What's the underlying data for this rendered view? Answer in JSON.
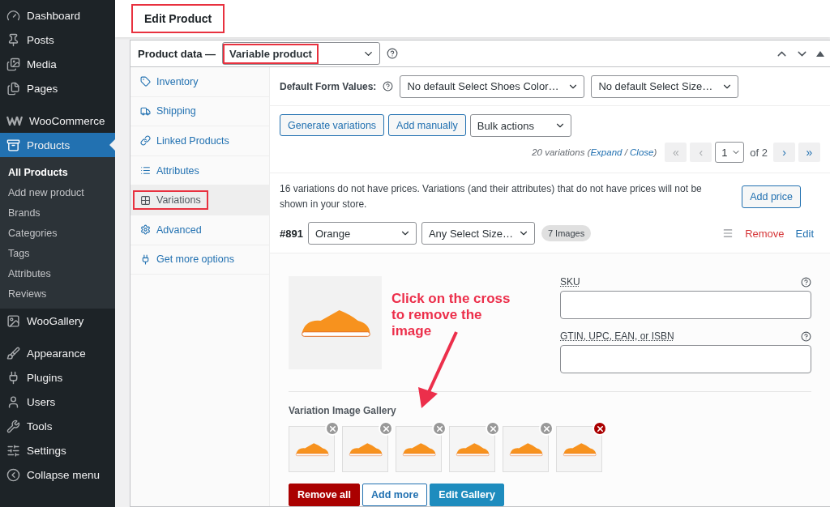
{
  "sidebar": {
    "groups": [
      [
        {
          "label": "Dashboard",
          "selected": false
        },
        {
          "label": "Posts",
          "selected": false
        },
        {
          "label": "Media",
          "selected": false
        },
        {
          "label": "Pages",
          "selected": false
        }
      ],
      [
        {
          "label": "WooCommerce",
          "selected": false
        },
        {
          "label": "Products",
          "selected": true,
          "children": [
            {
              "label": "All Products",
              "selected": true
            },
            {
              "label": "Add new product",
              "selected": false
            },
            {
              "label": "Brands",
              "selected": false
            },
            {
              "label": "Categories",
              "selected": false
            },
            {
              "label": "Tags",
              "selected": false
            },
            {
              "label": "Attributes",
              "selected": false
            },
            {
              "label": "Reviews",
              "selected": false
            }
          ]
        },
        {
          "label": "WooGallery",
          "selected": false
        }
      ],
      [
        {
          "label": "Appearance",
          "selected": false
        },
        {
          "label": "Plugins",
          "selected": false
        },
        {
          "label": "Users",
          "selected": false
        },
        {
          "label": "Tools",
          "selected": false
        },
        {
          "label": "Settings",
          "selected": false
        },
        {
          "label": "Collapse menu",
          "selected": false
        }
      ]
    ]
  },
  "page_title": {
    "text": "Edit Product",
    "highlighted": true
  },
  "product_data": {
    "label": "Product data —",
    "type_select": {
      "value": "Variable product",
      "highlighted": true
    },
    "tabs": [
      {
        "label": "Inventory",
        "selected": false,
        "highlighted": false
      },
      {
        "label": "Shipping",
        "selected": false,
        "highlighted": false
      },
      {
        "label": "Linked Products",
        "selected": false,
        "highlighted": false
      },
      {
        "label": "Attributes",
        "selected": false,
        "highlighted": false
      },
      {
        "label": "Variations",
        "selected": true,
        "highlighted": true
      },
      {
        "label": "Advanced",
        "selected": false,
        "highlighted": false
      },
      {
        "label": "Get more options",
        "selected": false,
        "highlighted": false
      }
    ]
  },
  "default_form": {
    "label": "Default Form Values:",
    "selects": [
      "No default Select Shoes Color…",
      "No default Select Size…"
    ]
  },
  "actions": {
    "buttons": [
      "Generate variations",
      "Add manually"
    ],
    "bulk_select": "Bulk actions"
  },
  "pagination": {
    "count": "20 variations",
    "open": "(",
    "expand": "Expand",
    "sep": "/",
    "close": "Close",
    "end": ")",
    "first": "«",
    "prev": "‹",
    "page": "1",
    "of": "of 2",
    "next": "›",
    "last": "»"
  },
  "notice": {
    "text": "16 variations do not have prices. Variations (and their attributes) that do not have prices will not be shown in your store.",
    "button": "Add price"
  },
  "variation": {
    "id": "#891",
    "selects": [
      "Orange",
      "Any Select Size…"
    ],
    "badge": "7 Images",
    "remove": "Remove",
    "edit": "Edit",
    "fields": [
      {
        "label": "SKU"
      },
      {
        "label": "GTIN, UPC, EAN, or ISBN"
      }
    ],
    "gallery_label": "Variation Image Gallery",
    "gallery": [
      {
        "remove_hover": false
      },
      {
        "remove_hover": false
      },
      {
        "remove_hover": false
      },
      {
        "remove_hover": false
      },
      {
        "remove_hover": false
      },
      {
        "remove_hover": true
      }
    ],
    "gallery_buttons": [
      {
        "kind": "danger",
        "label": "Remove all"
      },
      {
        "kind": "secondary",
        "label": "Add more"
      },
      {
        "kind": "primary",
        "label": "Edit Gallery"
      }
    ]
  },
  "annotation": {
    "text": "Click on the cross to remove the image"
  }
}
